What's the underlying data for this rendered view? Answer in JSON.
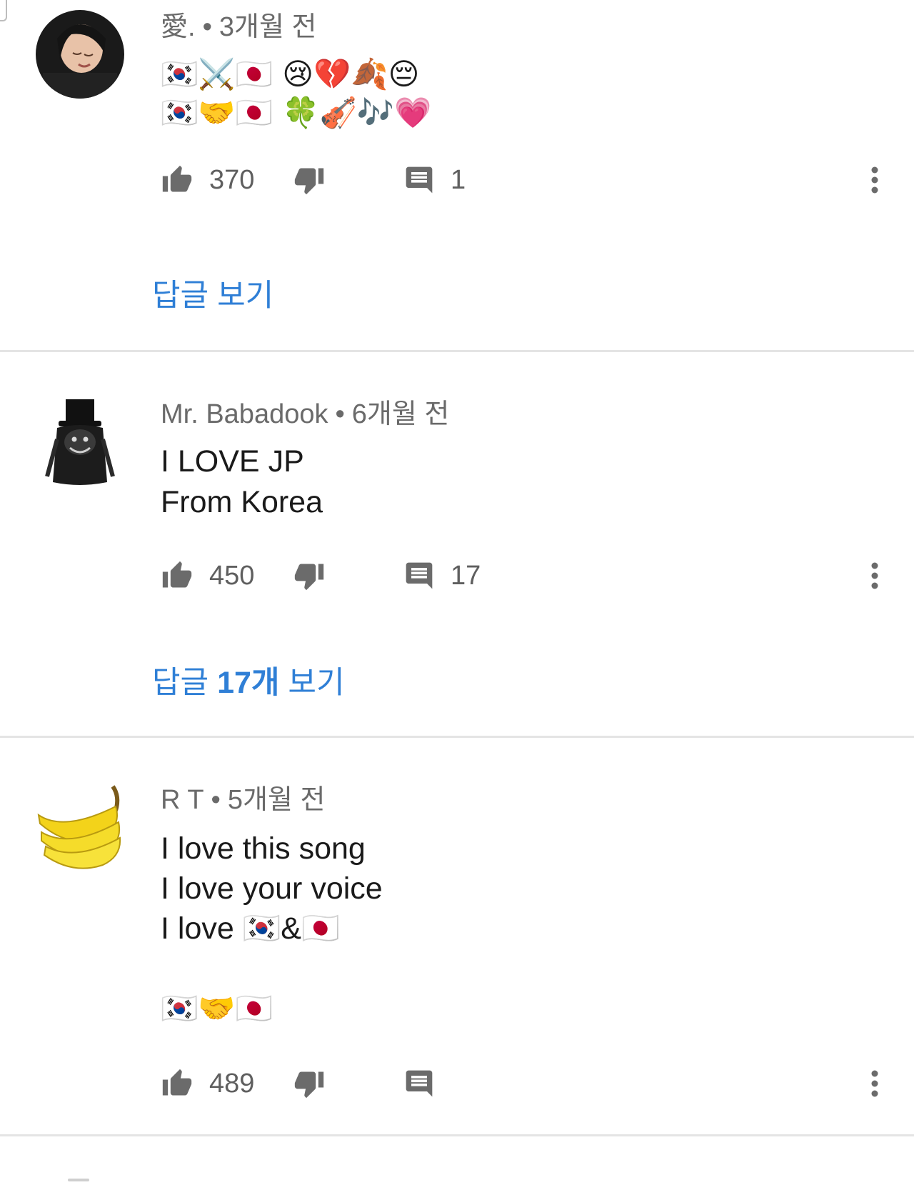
{
  "comments": [
    {
      "author": "愛.",
      "separator": "•",
      "time": "3개월 전",
      "avatar_icon": "girl-photo-avatar",
      "lines": [
        "🇰🇷⚔️🇯🇵  😢💔🍂😔",
        "🇰🇷🤝🇯🇵  🍀🎻🎶💗"
      ],
      "likes": "370",
      "replies_count": "1",
      "replies_link": "답글 보기"
    },
    {
      "author": "Mr. Babadook",
      "separator": "•",
      "time": "6개월 전",
      "avatar_icon": "babadook-avatar",
      "lines": [
        "I LOVE JP",
        "From Korea"
      ],
      "likes": "450",
      "replies_count": "17",
      "replies_link_prefix": "답글 ",
      "replies_link_count": "17개",
      "replies_link_suffix": " 보기"
    },
    {
      "author": "R T",
      "separator": "•",
      "time": "5개월 전",
      "avatar_icon": "banana-avatar",
      "lines": [
        "I love this song",
        "I love your voice",
        "I love 🇰🇷&🇯🇵",
        "🇰🇷🤝🇯🇵"
      ],
      "likes": "489",
      "replies_count": ""
    }
  ],
  "icons": {
    "like": "thumbs-up-icon",
    "dislike": "thumbs-down-icon",
    "reply": "comment-icon",
    "more": "more-vert-icon"
  },
  "colors": {
    "link": "#2f7fd6",
    "meta": "#6a6a6a",
    "icon": "#6b6b6b",
    "divider": "#e4e4e4"
  }
}
